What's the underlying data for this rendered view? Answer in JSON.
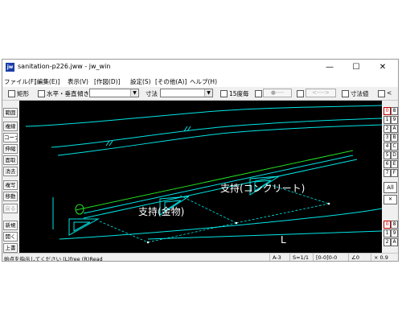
{
  "window": {
    "title": "sanitation-p226.jww - jw_win",
    "icon_label": "jw"
  },
  "window_controls": {
    "minimize": "—",
    "maximize": "☐",
    "close": "✕"
  },
  "menu": [
    "ファイル(F)",
    "[編集(E)]",
    "表示(V)",
    "[作図(D)]",
    "設定(S)",
    "[その他(A)]",
    "ヘルプ(H)"
  ],
  "toolbar": {
    "rect_label": "矩形",
    "horiz_vert_label": "水平・垂直",
    "slope_label": "傾き",
    "dim_label": "寸法",
    "deg15_label": "15度毎",
    "circle_pill": "●----",
    "arrow_pill": "<---->",
    "dimval_label": "寸法値",
    "lt_label": "<"
  },
  "left_tools": [
    "範囲",
    "複線",
    "コーナー",
    "伸縮",
    "面取",
    "消去",
    "複写",
    "移動",
    "戻る",
    "新規",
    "開く",
    "上書"
  ],
  "right_tools": {
    "layer_group_top": [
      "0",
      "8",
      "1",
      "9",
      "2",
      "A",
      "3",
      "B",
      "4",
      "C",
      "5",
      "D",
      "6",
      "E",
      "7",
      "F"
    ],
    "all_label": "All",
    "x_label": "✕",
    "layer_group_bottom": [
      "0",
      "8",
      "1",
      "9",
      "2",
      "A"
    ]
  },
  "drawing": {
    "label_concrete": "支持(コンクリート)",
    "label_metal": "支持(金物)",
    "label_L1": "L",
    "label_L2": "L"
  },
  "statusbar": {
    "message": "始点を指示してください (L)free (R)Read",
    "paper": "A-3",
    "scale": "S=1/1",
    "layer": "[0-0]0-0",
    "angle": "∠0",
    "zoom": "× 0.9"
  },
  "colors": {
    "canvas_bg": "#000000",
    "cyan": "#00e5e5",
    "green": "#22dd22",
    "white": "#ffffff",
    "layer_red": "#cc0000"
  }
}
